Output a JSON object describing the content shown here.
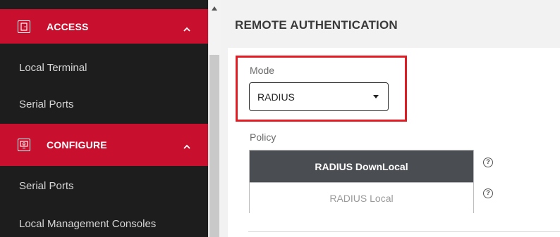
{
  "sidebar": {
    "sections": [
      {
        "label": "ACCESS",
        "icon": "door-icon",
        "items": [
          "Local Terminal",
          "Serial Ports"
        ]
      },
      {
        "label": "CONFIGURE",
        "icon": "monitor-gear-icon",
        "items": [
          "Serial Ports",
          "Local Management Consoles"
        ]
      }
    ]
  },
  "page": {
    "title": "REMOTE AUTHENTICATION"
  },
  "form": {
    "mode_label": "Mode",
    "mode_value": "RADIUS",
    "policy_label": "Policy",
    "policy_options": [
      "RADIUS DownLocal",
      "RADIUS Local"
    ],
    "help_glyph": "?"
  },
  "colors": {
    "accent": "#c8102e",
    "highlight": "#e31b23",
    "sidebar_bg": "#1d1d1d",
    "selected_row": "#4a4d52"
  }
}
